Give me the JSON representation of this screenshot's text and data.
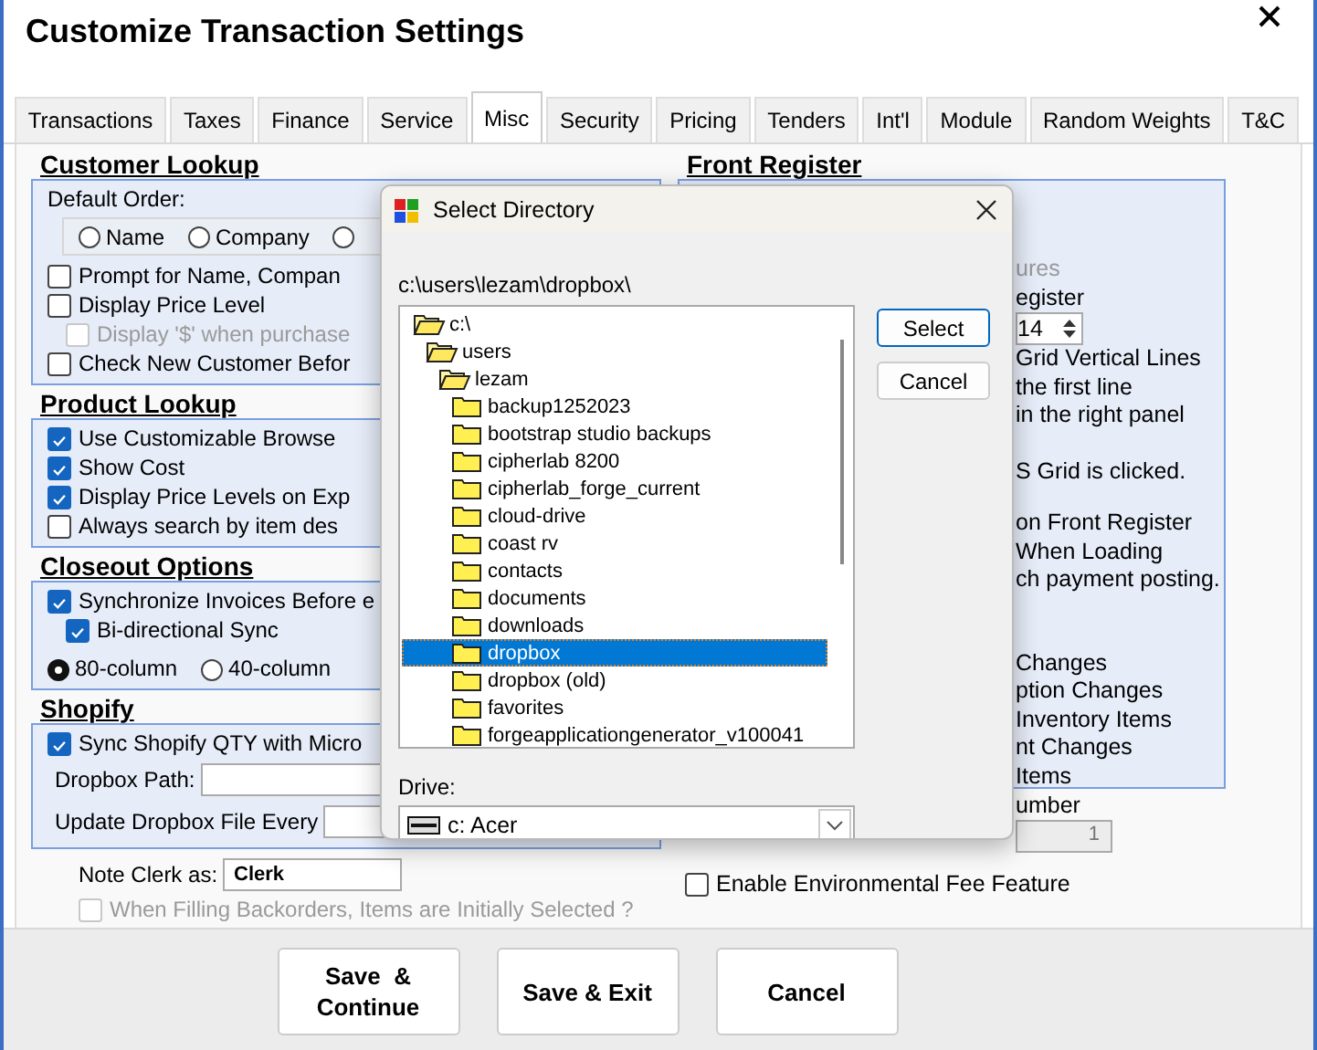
{
  "window": {
    "title": "Customize Transaction Settings"
  },
  "tabs": [
    {
      "label": "Transactions",
      "selected": false
    },
    {
      "label": "Taxes",
      "selected": false
    },
    {
      "label": "Finance",
      "selected": false
    },
    {
      "label": "Service",
      "selected": false
    },
    {
      "label": "Misc",
      "selected": true
    },
    {
      "label": "Security",
      "selected": false
    },
    {
      "label": "Pricing",
      "selected": false
    },
    {
      "label": "Tenders",
      "selected": false
    },
    {
      "label": "Int'l",
      "selected": false
    },
    {
      "label": "Module",
      "selected": false
    },
    {
      "label": "Random Weights",
      "selected": false
    },
    {
      "label": "T&C",
      "selected": false
    }
  ],
  "left_sections": [
    {
      "heading": "Customer Lookup",
      "items": [
        {
          "kind": "label",
          "text": "Default Order:"
        },
        {
          "kind": "radio_group",
          "options": [
            {
              "label": "Name",
              "selected": false
            },
            {
              "label": "Company",
              "selected": false
            },
            {
              "selected": false
            }
          ]
        },
        {
          "kind": "checkbox",
          "label": "Prompt for Name, Compan",
          "checked": false,
          "disabled": false
        },
        {
          "kind": "checkbox",
          "label": "Display Price Level",
          "checked": false,
          "disabled": false,
          "children": [
            {
              "kind": "checkbox",
              "label": "Display '$' when purchase",
              "checked": false,
              "disabled": true
            }
          ]
        },
        {
          "kind": "checkbox",
          "label": "Check New Customer Befor",
          "checked": false,
          "disabled": false
        }
      ]
    },
    {
      "heading": "Product Lookup",
      "items": [
        {
          "kind": "checkbox",
          "label": "Use Customizable Browse",
          "checked": true,
          "disabled": false
        },
        {
          "kind": "checkbox",
          "label": "Show Cost",
          "checked": true,
          "disabled": false
        },
        {
          "kind": "checkbox",
          "label": "Display Price Levels on Exp",
          "checked": true,
          "disabled": false
        },
        {
          "kind": "checkbox",
          "label": "Always search by item des",
          "checked": false,
          "disabled": false
        }
      ]
    },
    {
      "heading": "Closeout Options",
      "items": [
        {
          "kind": "checkbox",
          "label": "Synchronize Invoices Before e",
          "checked": true,
          "disabled": false,
          "children": [
            {
              "kind": "checkbox",
              "label": "Bi-directional Sync",
              "checked": true,
              "disabled": false
            }
          ]
        },
        {
          "kind": "radio_row",
          "options": [
            {
              "label": "80-column",
              "selected": true
            },
            {
              "label": "40-column",
              "selected": false
            }
          ]
        }
      ]
    },
    {
      "heading": "Shopify",
      "items": [
        {
          "kind": "checkbox",
          "label": "Sync Shopify QTY with Micro",
          "checked": true,
          "disabled": false
        },
        {
          "kind": "field",
          "label": "Dropbox Path:"
        },
        {
          "kind": "field",
          "label": "Update Dropbox File Every"
        }
      ]
    }
  ],
  "note_clerk": {
    "label": "Note Clerk as:",
    "value": "Clerk"
  },
  "backorders": {
    "label": "When Filling Backorders, Items are Initially Selected ?",
    "checked": false,
    "disabled": true
  },
  "front_register": {
    "heading": "Front Register",
    "groups": [
      [
        {
          "kind": "text",
          "text": "ures",
          "disabled": true
        },
        {
          "kind": "text",
          "text": "egister",
          "disabled": false
        },
        {
          "kind": "spinner",
          "value": "14"
        },
        {
          "kind": "text",
          "text": "Grid Vertical Lines",
          "disabled": false
        },
        {
          "kind": "text",
          "text": "the first line",
          "disabled": false
        },
        {
          "kind": "text",
          "text": "in the right panel",
          "disabled": false
        }
      ],
      [
        {
          "kind": "text",
          "text": "S Grid is clicked.",
          "disabled": false
        }
      ],
      [
        {
          "kind": "text",
          "text": "on Front Register",
          "disabled": false
        },
        {
          "kind": "text",
          "text": "When Loading",
          "disabled": false
        },
        {
          "kind": "text",
          "text": "ch payment posting.",
          "disabled": false
        }
      ],
      [
        {
          "kind": "text",
          "text": "Changes",
          "disabled": false
        },
        {
          "kind": "text",
          "text": "ption Changes",
          "disabled": false
        },
        {
          "kind": "text",
          "text": "Inventory Items",
          "disabled": false
        },
        {
          "kind": "text",
          "text": "nt Changes",
          "disabled": false
        },
        {
          "kind": "text",
          "text": "Items",
          "disabled": false
        }
      ]
    ],
    "number_label": "umber",
    "number_value": "1",
    "env_fee": {
      "label": "Enable Environmental Fee Feature",
      "checked": false
    }
  },
  "buttons": [
    {
      "lines": [
        "Save  &",
        "Continue"
      ]
    },
    {
      "lines": [
        "Save & Exit"
      ]
    },
    {
      "lines": [
        "Cancel"
      ]
    }
  ],
  "dialog": {
    "title": "Select Directory",
    "path": "c:\\users\\lezam\\dropbox\\",
    "tree": [
      {
        "label": "c:\\",
        "expanded": true,
        "selected": false,
        "children": [
          {
            "label": "users",
            "expanded": true,
            "selected": false,
            "children": [
              {
                "label": "lezam",
                "expanded": true,
                "selected": false,
                "children": [
                  {
                    "label": "backup1252023",
                    "expanded": false,
                    "selected": false
                  },
                  {
                    "label": "bootstrap studio backups",
                    "expanded": false,
                    "selected": false
                  },
                  {
                    "label": "cipherlab 8200",
                    "expanded": false,
                    "selected": false
                  },
                  {
                    "label": "cipherlab_forge_current",
                    "expanded": false,
                    "selected": false
                  },
                  {
                    "label": "cloud-drive",
                    "expanded": false,
                    "selected": false
                  },
                  {
                    "label": "coast rv",
                    "expanded": false,
                    "selected": false
                  },
                  {
                    "label": "contacts",
                    "expanded": false,
                    "selected": false
                  },
                  {
                    "label": "documents",
                    "expanded": false,
                    "selected": false
                  },
                  {
                    "label": "downloads",
                    "expanded": false,
                    "selected": false
                  },
                  {
                    "label": "dropbox",
                    "expanded": false,
                    "selected": true
                  },
                  {
                    "label": "dropbox (old)",
                    "expanded": false,
                    "selected": false
                  },
                  {
                    "label": "favorites",
                    "expanded": false,
                    "selected": false
                  },
                  {
                    "label": "forgeapplicationgenerator_v100041",
                    "expanded": false,
                    "selected": false
                  }
                ]
              }
            ]
          }
        ]
      }
    ],
    "buttons": [
      {
        "label": "Select",
        "default": true
      },
      {
        "label": "Cancel",
        "default": false
      }
    ],
    "drive_label": "Drive:",
    "drive": "c: Acer"
  }
}
